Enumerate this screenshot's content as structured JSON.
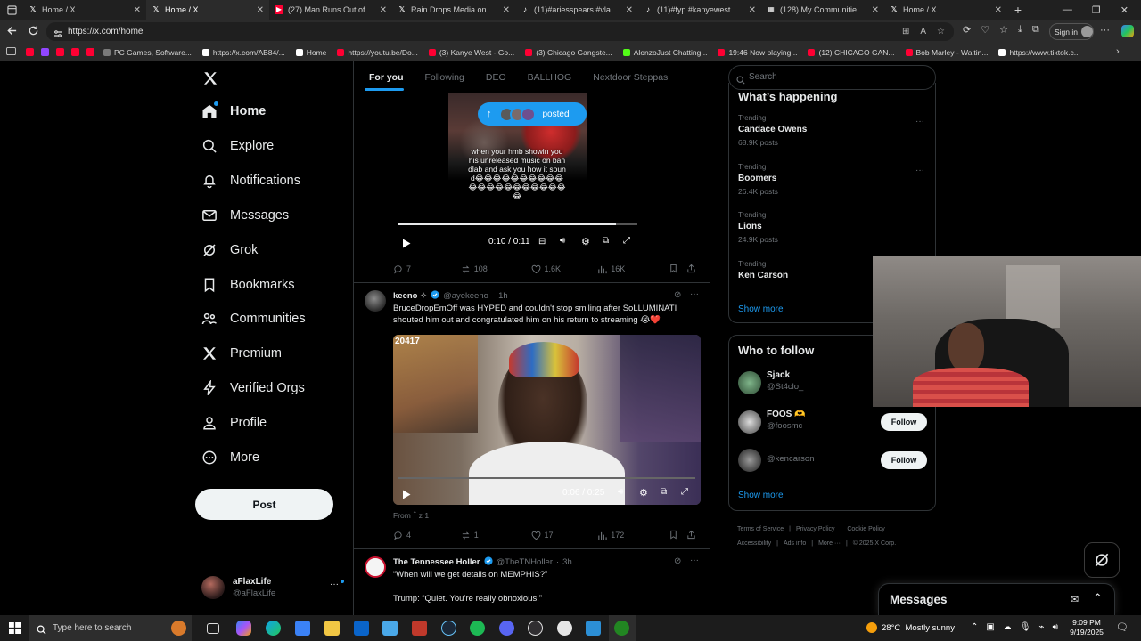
{
  "browser": {
    "tabs": [
      {
        "label": "Home / X",
        "icon": "x-logo-icon",
        "color": "#ffffff"
      },
      {
        "label": "Home / X",
        "icon": "x-logo-icon",
        "color": "#ffffff",
        "active": true
      },
      {
        "label": "(27) Man Runs Out of Gas W",
        "icon": "youtube-icon",
        "color": "#ff0033"
      },
      {
        "label": "Rain Drops Media on X: \"In",
        "icon": "x-logo-icon",
        "color": "#ffffff"
      },
      {
        "label": "(11)#ariesspears #vladtv #",
        "icon": "tiktok-icon",
        "color": "#ffffff"
      },
      {
        "label": "(11)#fyp #kanyewest #ye #",
        "icon": "tiktok-icon",
        "color": "#ffffff"
      },
      {
        "label": "(128) My Communities - de",
        "icon": "grid-icon",
        "color": "#ffffff"
      },
      {
        "label": "Home / X",
        "icon": "x-logo-icon",
        "color": "#ffffff"
      }
    ],
    "url": "https://x.com/home",
    "signin_label": "Sign in",
    "bookmarks": [
      {
        "label": "PC Games, Software...",
        "color": "#7a7a7a"
      },
      {
        "label": "https://x.com/AB84/...",
        "color": "#ffffff"
      },
      {
        "label": "Home",
        "color": "#ffffff"
      },
      {
        "label": "https://youtu.be/Do...",
        "color": "#ff0033"
      },
      {
        "label": "(3) Kanye West - Go...",
        "color": "#ff0033"
      },
      {
        "label": "(3) Chicago Gangste...",
        "color": "#ff0033"
      },
      {
        "label": "AlonzoJust Chatting...",
        "color": "#53fc18"
      },
      {
        "label": "19:46 Now playing...",
        "color": "#ff0033"
      },
      {
        "label": "(12) CHICAGO GAN...",
        "color": "#ff0033"
      },
      {
        "label": "Bob Marley - Waitin...",
        "color": "#ff0033"
      },
      {
        "label": "https://www.tiktok.c...",
        "color": "#ffffff"
      }
    ]
  },
  "nav": {
    "items": [
      {
        "label": "Home",
        "icon": "home-icon"
      },
      {
        "label": "Explore",
        "icon": "search-icon"
      },
      {
        "label": "Notifications",
        "icon": "bell-icon"
      },
      {
        "label": "Messages",
        "icon": "mail-icon"
      },
      {
        "label": "Grok",
        "icon": "grok-icon"
      },
      {
        "label": "Bookmarks",
        "icon": "bookmark-icon"
      },
      {
        "label": "Communities",
        "icon": "people-icon"
      },
      {
        "label": "Premium",
        "icon": "x-logo-icon"
      },
      {
        "label": "Verified Orgs",
        "icon": "lightning-icon"
      },
      {
        "label": "Profile",
        "icon": "person-icon"
      },
      {
        "label": "More",
        "icon": "more-circle-icon"
      }
    ],
    "post_label": "Post",
    "account": {
      "name": "aFlaxLife",
      "handle": "@aFlaxLife"
    }
  },
  "feed": {
    "tabs": [
      "For you",
      "Following",
      "DEO",
      "BALLHOG",
      "Nextdoor Steppas"
    ],
    "posted_pill": "posted",
    "video1": {
      "caption": "when your hmb showin you his unreleased music on bandlab and ask you how it sound😂😂😂😂😂😂😂😂😂😂😂😂😂😂😂😂😂😂😂😂😂😂",
      "time": "0:10 / 0:11",
      "progress": 0.91
    },
    "tweet1_stats": {
      "replies": "7",
      "reposts": "108",
      "likes": "1.6K",
      "views": "16K"
    },
    "tweet2": {
      "name": "keeno ✧",
      "handle": "@ayekeeno",
      "time": "1h",
      "text_line1": "BruceDropEmOff was HYPED and couldn't stop smiling after SoLLUMINATI",
      "text_line2": "shouted him out and congratulated him on his return to streaming 😭❤️",
      "video_overlay": "20417",
      "video_time": "0:06 / 0:25",
      "from": "From ꜛ z 1",
      "stats": {
        "replies": "4",
        "reposts": "1",
        "likes": "17",
        "views": "172"
      }
    },
    "tweet3": {
      "name": "The Tennessee Holler",
      "handle": "@TheTNHoller",
      "time": "3h",
      "line1": "“When will we get details on MEMPHIS?”",
      "line2": "Trump: “Quiet. You’re really obnoxious.”"
    }
  },
  "right": {
    "search_placeholder": "Search",
    "whats_happening": "What’s happening",
    "trends": [
      {
        "category": "Trending",
        "name": "Candace Owens",
        "posts": "68.9K posts"
      },
      {
        "category": "Trending",
        "name": "Boomers",
        "posts": "26.4K posts"
      },
      {
        "category": "Trending",
        "name": "Lions",
        "posts": "24.9K posts"
      },
      {
        "category": "Trending",
        "name": "Ken Carson",
        "posts": ""
      }
    ],
    "show_more": "Show more",
    "who_to_follow": "Who to follow",
    "follow_suggestions": [
      {
        "name": "Sjack",
        "handle": "@St4clo_",
        "button": "Follow"
      },
      {
        "name": "FOOS 🫶",
        "handle": "@foosmc",
        "button": "Follow"
      },
      {
        "name": "",
        "handle": "@kencarson",
        "button": "Follow"
      }
    ],
    "footer_row1": [
      "Terms of Service",
      "Privacy Policy",
      "Cookie Policy"
    ],
    "footer_row2": [
      "Accessibility",
      "Ads info",
      "More ···",
      "© 2025 X Corp."
    ]
  },
  "messages_drawer": {
    "title": "Messages"
  },
  "taskbar": {
    "search_placeholder": "Type here to search",
    "weather": "28°C  Mostly sunny",
    "time": "9:09 PM",
    "date": "9/19/2025"
  }
}
